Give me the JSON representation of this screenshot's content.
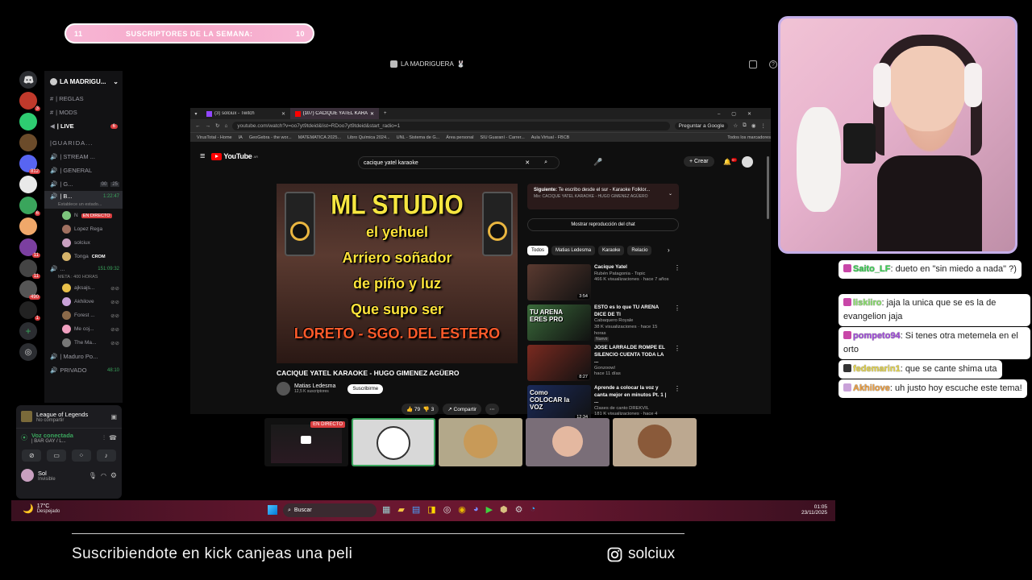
{
  "subs_banner": {
    "left": "11",
    "label": "SUSCRIPTORES DE LA SEMANA:",
    "right": "10"
  },
  "window_title": "LA MADRIGUERA",
  "discord": {
    "servers": [
      {
        "badge": "3",
        "color": "#c0392b"
      },
      {
        "badge": "",
        "color": "#2ecc71"
      },
      {
        "badge": "",
        "color": "#6b4b2a"
      },
      {
        "badge": "812",
        "color": "#5865f2"
      },
      {
        "badge": "",
        "color": "#e9e9e9"
      },
      {
        "badge": "6",
        "color": "#3aa55c"
      },
      {
        "badge": "",
        "color": "#f0a86a"
      },
      {
        "badge": "11",
        "color": "#7b3fa0"
      },
      {
        "badge": "11",
        "color": "#444"
      },
      {
        "badge": "490",
        "color": "#555"
      },
      {
        "badge": "1",
        "color": "#222"
      }
    ],
    "server_name": "LA MADRIGU...",
    "channels": [
      {
        "icon": "#",
        "label": "| REGLAS"
      },
      {
        "icon": "#",
        "label": "| MODS"
      },
      {
        "icon": "◀",
        "label": "| LIVE",
        "badge": "6"
      }
    ],
    "category": "|GUARIDA...",
    "voice": [
      {
        "label": "| STREAM ..."
      },
      {
        "label": "| GENERAL"
      },
      {
        "label": "| G...",
        "count": "00",
        "limit": "25"
      }
    ],
    "active_voice": {
      "label": "| B...",
      "timer": "1:22:47",
      "status": "Establece un estado..."
    },
    "active_users": [
      {
        "name": "N",
        "tag": "EN DIRECTO",
        "color": "#7cc47c"
      },
      {
        "name": "Lopez Rega",
        "tag": "",
        "color": "#a07060"
      },
      {
        "name": "solciux",
        "tag": "",
        "color": "#c9a0c0"
      },
      {
        "name": "Tonga",
        "tag": "CROM",
        "color": "#d6b36a"
      }
    ],
    "voice2": {
      "label": "...",
      "timer": "151:09:32",
      "meta": "META : 400 HORAS"
    },
    "voice2_users": [
      {
        "name": "ajksajs...",
        "color": "#e8c04a"
      },
      {
        "name": "Akhilove",
        "color": "#c9a2d9"
      },
      {
        "name": "Forest ...",
        "color": "#8b6a4a"
      },
      {
        "name": "Me coj...",
        "color": "#f0a0c0"
      },
      {
        "name": "The Ma...",
        "color": "#777"
      }
    ],
    "extra_channels": [
      {
        "label": "| Maduro Po..."
      },
      {
        "label": "PRIVADO",
        "timer": "48:10"
      }
    ],
    "game": {
      "title": "League of Legends",
      "sub": "No compartir"
    },
    "voice_status": {
      "title": "Voz conectada",
      "sub": "| BAR GAY / L..."
    },
    "user": {
      "name": "Sol",
      "status": "Invisible"
    }
  },
  "browser": {
    "tabs": [
      {
        "label": "(3) solciux - Twitch"
      },
      {
        "label": "(107) CACIQUE YATEL KARA..."
      }
    ],
    "url": "youtube.com/watch?v=oo7yt9tdeid&list=RDoo7yt9tdeid&start_radio=1",
    "ask_google": "Preguntar a Google",
    "bookmarks": [
      "VirusTotal - Home",
      "IA",
      "GeoGebra - the wor...",
      "MATEMATICA 2025...",
      "Libro Química 2024...",
      "UNL - Sistema de G...",
      "Área personal",
      "SIU Guaraní - Carrer...",
      "Aula Virtual - FBCB",
      "Todos los marcadores"
    ],
    "yt_logo": "YouTube",
    "yt_country": "AR",
    "search_query": "cacique yatel karaoke",
    "create_label": "Crear",
    "notif_count": "9+",
    "video_lyrics": [
      "ML STUDIO",
      "el yehuel",
      "Arriero soñador",
      "de piño y luz",
      "Que supo ser",
      "LORETO - SGO. DEL ESTERO"
    ],
    "video_title": "CACIQUE YATEL KARAOKE - HUGO GIMENEZ AGÜERO",
    "channel_name": "Matias Ledesma",
    "channel_subs": "12,5 K suscriptores",
    "subscribe": "Suscribirme",
    "likes": "79",
    "dislikes": "3",
    "share": "Compartir",
    "up_next": {
      "label": "Siguiente:",
      "title": "Te escribo desde el sur - Karaoke Folklor...",
      "sub": "Mix: CACIQUE YATEL KARAOKE - HUGO GIMENEZ AGÜERO"
    },
    "chat_replay": "Mostrar reproducción del chat",
    "chips": [
      "Todos",
      "Matias Ledesma",
      "Karaoke",
      "Relacio"
    ],
    "recommended": [
      {
        "title": "Cacique Yatel",
        "channel": "Rubén Patagonia - Topic",
        "meta": "466 K visualizaciones · hace 7 años",
        "duration": "3:54",
        "color": "#5a3a30"
      },
      {
        "title": "ESTO es lo que TU ARENA DICE DE TI",
        "channel": "Cabaquero Royale",
        "meta": "38 K visualizaciones · hace 15 horas",
        "badge": "Nuevo",
        "duration": "",
        "thumb_text": "TU ARENA ERES PRO",
        "color": "#3a6a3a"
      },
      {
        "title": "JOSE LARRALDE ROMPE EL SILENCIO CUENTA TODA LA ...",
        "channel": "Gonzoowl",
        "meta": "hace 11 días",
        "duration": "8:27",
        "color": "#7a2a20"
      },
      {
        "title": "Aprende a colocar la voz y canta mejor en minutos Pt. 1 | ...",
        "channel": "Clases de canto DREKVIL",
        "meta": "181 K visualizaciones · hace 4 meses",
        "duration": "12:34",
        "thumb_text": "Como COLOCAR la VOZ",
        "color": "#1a2a5a"
      }
    ]
  },
  "cams": {
    "live_tag": "EN DIRECTO"
  },
  "taskbar": {
    "weather": "17°C",
    "weather_sub": "Despejado",
    "search": "Buscar",
    "time": "01:05",
    "date": "23/11/2025"
  },
  "chat": [
    {
      "name": "Saito_LF",
      "text": ": dueto en \"sin miedo a nada\" ?)",
      "name_color": "#39d353",
      "icon_color": "#c846a8"
    },
    {
      "name": "liskiiro",
      "text": ": jaja la unica que se es la de evangelion jaja",
      "name_color": "#8be36c",
      "icon_color": "#c846a8"
    },
    {
      "name": "pompeto94",
      "text": ": Si tenes otra metemela en el orto",
      "name_color": "#a54fe0",
      "icon_color": "#c846a8"
    },
    {
      "name": "fedemarin1",
      "text": ": que se cante shima uta",
      "name_color": "#e8d84a",
      "icon_color": "#333"
    },
    {
      "name": "Akhilove",
      "text": ": uh justo hoy escuche este tema!",
      "name_color": "#f0a040",
      "icon_color": "#c9a2d9"
    }
  ],
  "footer": {
    "promo": "Suscribiendote en kick canjeas una peli",
    "instagram": "solciux"
  }
}
